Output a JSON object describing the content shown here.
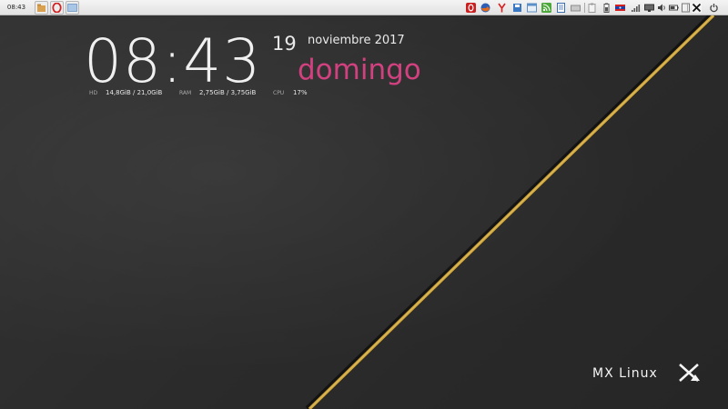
{
  "panel": {
    "clock": "08:43",
    "launchers": [
      {
        "icon": "file-manager-icon",
        "color": "#d9a050"
      },
      {
        "icon": "opera-browser-icon",
        "color": "#d02020"
      },
      {
        "icon": "show-desktop-icon",
        "color": "#7aa6d4"
      }
    ],
    "tray": [
      {
        "icon": "opera-tray-icon",
        "color": "#cc1f1f"
      },
      {
        "icon": "firefox-icon",
        "color": "#e26a1d"
      },
      {
        "icon": "yandex-icon",
        "color": "#d81e1e"
      },
      {
        "icon": "disk-tool-icon",
        "color": "#3a78c4"
      },
      {
        "icon": "settings-window-icon",
        "color": "#5b8fc8"
      },
      {
        "icon": "rss-icon",
        "color": "#4ca83a"
      },
      {
        "icon": "document-icon",
        "color": "#3b6fb2"
      },
      {
        "icon": "keyboard-icon",
        "color": "#8c8c8c"
      },
      {
        "icon": "clipboard-icon",
        "color": "#9a9a9a"
      },
      {
        "icon": "battery-monitor-icon",
        "color": "#555555"
      },
      {
        "icon": "keyboard-layout-flag-icon",
        "color": "#d61f1f"
      },
      {
        "icon": "network-signal-icon",
        "color": "#555555"
      },
      {
        "icon": "display-icon",
        "color": "#444444"
      },
      {
        "icon": "volume-icon",
        "color": "#444444"
      },
      {
        "icon": "battery-icon",
        "color": "#444444"
      },
      {
        "icon": "disk-icon",
        "color": "#777777"
      },
      {
        "icon": "mx-logout-icon",
        "color": "#111111"
      },
      {
        "icon": "power-icon",
        "color": "#444444"
      }
    ]
  },
  "conky": {
    "time": "08:43",
    "day": "19",
    "month_year": "noviembre 2017",
    "weekday": "domingo",
    "weekday_color": "#d2417f",
    "stats": [
      {
        "label": "HD",
        "value": "14,8GiB / 21,0GiB"
      },
      {
        "label": "RAM",
        "value": "2,75GiB / 3,75GiB"
      },
      {
        "label": "CPU",
        "value": "17%"
      }
    ]
  },
  "wallpaper": {
    "stripe_color": "#c9a03a",
    "logo_text": "MX Linux"
  }
}
